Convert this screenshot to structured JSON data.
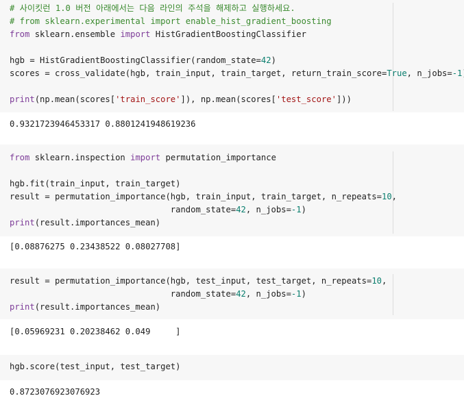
{
  "cells": [
    {
      "type": "input",
      "lines": [
        [
          {
            "t": "# 사이킷런 1.0 버전 아래에서는 다음 라인의 주석을 해제하고 실행하세요.",
            "c": "cm"
          }
        ],
        [
          {
            "t": "# from sklearn.experimental import enable_hist_gradient_boosting",
            "c": "cm"
          }
        ],
        [
          {
            "t": "from",
            "c": "kw"
          },
          {
            "t": " sklearn.ensemble ",
            "c": ""
          },
          {
            "t": "import",
            "c": "kw"
          },
          {
            "t": " HistGradientBoostingClassifier",
            "c": ""
          }
        ],
        [
          {
            "t": "",
            "c": ""
          }
        ],
        [
          {
            "t": "hgb = HistGradientBoostingClassifier(random_state=",
            "c": ""
          },
          {
            "t": "42",
            "c": "num"
          },
          {
            "t": ")",
            "c": ""
          }
        ],
        [
          {
            "t": "scores = cross_validate(hgb, train_input, train_target, return_train_score=",
            "c": ""
          },
          {
            "t": "True",
            "c": "bool"
          },
          {
            "t": ", n_jobs=",
            "c": ""
          },
          {
            "t": "-1",
            "c": "num"
          },
          {
            "t": ")",
            "c": ""
          }
        ],
        [
          {
            "t": "",
            "c": ""
          }
        ],
        [
          {
            "t": "print",
            "c": "bi"
          },
          {
            "t": "(np.mean(scores[",
            "c": ""
          },
          {
            "t": "'train_score'",
            "c": "str"
          },
          {
            "t": "]), np.mean(scores[",
            "c": ""
          },
          {
            "t": "'test_score'",
            "c": "str"
          },
          {
            "t": "]))",
            "c": ""
          }
        ]
      ]
    },
    {
      "type": "output",
      "text": "0.9321723946453317 0.8801241948619236"
    },
    {
      "type": "input",
      "lines": [
        [
          {
            "t": "from",
            "c": "kw"
          },
          {
            "t": " sklearn.inspection ",
            "c": ""
          },
          {
            "t": "import",
            "c": "kw"
          },
          {
            "t": " permutation_importance",
            "c": ""
          }
        ],
        [
          {
            "t": "",
            "c": ""
          }
        ],
        [
          {
            "t": "hgb.fit(train_input, train_target)",
            "c": ""
          }
        ],
        [
          {
            "t": "result = permutation_importance(hgb, train_input, train_target, n_repeats=",
            "c": ""
          },
          {
            "t": "10",
            "c": "num"
          },
          {
            "t": ",",
            "c": ""
          }
        ],
        [
          {
            "t": "                                random_state=",
            "c": ""
          },
          {
            "t": "42",
            "c": "num"
          },
          {
            "t": ", n_jobs=",
            "c": ""
          },
          {
            "t": "-1",
            "c": "num"
          },
          {
            "t": ")",
            "c": ""
          }
        ],
        [
          {
            "t": "print",
            "c": "bi"
          },
          {
            "t": "(result.importances_mean)",
            "c": ""
          }
        ]
      ]
    },
    {
      "type": "output",
      "text": "[0.08876275 0.23438522 0.08027708]"
    },
    {
      "type": "input",
      "lines": [
        [
          {
            "t": "result = permutation_importance(hgb, test_input, test_target, n_repeats=",
            "c": ""
          },
          {
            "t": "10",
            "c": "num"
          },
          {
            "t": ",",
            "c": ""
          }
        ],
        [
          {
            "t": "                                random_state=",
            "c": ""
          },
          {
            "t": "42",
            "c": "num"
          },
          {
            "t": ", n_jobs=",
            "c": ""
          },
          {
            "t": "-1",
            "c": "num"
          },
          {
            "t": ")",
            "c": ""
          }
        ],
        [
          {
            "t": "print",
            "c": "bi"
          },
          {
            "t": "(result.importances_mean)",
            "c": ""
          }
        ]
      ]
    },
    {
      "type": "output",
      "text": "[0.05969231 0.20238462 0.049     ]"
    },
    {
      "type": "input",
      "lines": [
        [
          {
            "t": "hgb.score(test_input, test_target)",
            "c": ""
          }
        ]
      ]
    },
    {
      "type": "output",
      "text": "0.8723076923076923"
    }
  ]
}
